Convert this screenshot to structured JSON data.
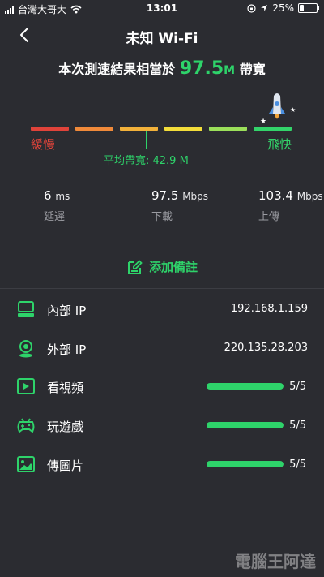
{
  "status_bar": {
    "carrier": "台灣大哥大",
    "time": "13:01",
    "battery": "25%"
  },
  "nav": {
    "title": "未知 Wi-Fi"
  },
  "headline": {
    "prefix": "本次測速結果相當於",
    "speed": "97.5",
    "unit": "M",
    "suffix": "帶寬"
  },
  "scale": {
    "segments": [
      {
        "color": "#e0433a"
      },
      {
        "color": "#f08a3a"
      },
      {
        "color": "#f2b13a"
      },
      {
        "color": "#f3dd3a"
      },
      {
        "color": "#9be05a"
      },
      {
        "color": "#33d46a"
      }
    ],
    "slow_label": "緩慢",
    "fast_label": "飛快",
    "average_text": "平均帶寬: 42.9 M"
  },
  "metrics": [
    {
      "value": "6",
      "unit": "ms",
      "label": "延遲"
    },
    {
      "value": "97.5",
      "unit": "Mbps",
      "label": "下載"
    },
    {
      "value": "103.4",
      "unit": "Mbps",
      "label": "上傳"
    }
  ],
  "add_note": {
    "label": "添加備註"
  },
  "info_rows": [
    {
      "icon": "router-icon",
      "name": "內部 IP",
      "value": "192.168.1.159"
    },
    {
      "icon": "location-pin-icon",
      "name": "外部 IP",
      "value": "220.135.28.203"
    }
  ],
  "score_rows": [
    {
      "icon": "video-play-icon",
      "name": "看視頻",
      "score": "5/5",
      "fraction": 1.0
    },
    {
      "icon": "gamepad-icon",
      "name": "玩遊戲",
      "score": "5/5",
      "fraction": 1.0
    },
    {
      "icon": "image-icon",
      "name": "傳圖片",
      "score": "5/5",
      "fraction": 1.0
    }
  ],
  "colors": {
    "accent": "#2ed36a",
    "background": "#2b2c31"
  },
  "watermark": "電腦王阿達"
}
